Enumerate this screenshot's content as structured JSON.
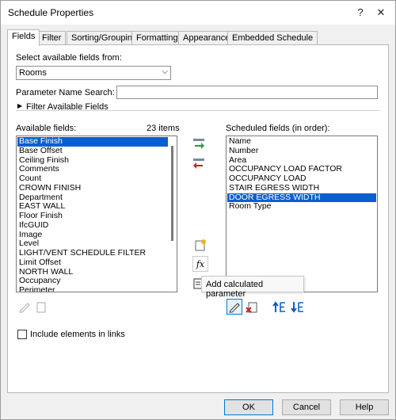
{
  "window": {
    "title": "Schedule Properties",
    "help_icon": "?",
    "close_icon": "✕"
  },
  "tabs": [
    "Fields",
    "Filter",
    "Sorting/Grouping",
    "Formatting",
    "Appearance",
    "Embedded Schedule"
  ],
  "fields": {
    "select_label": "Select available fields from:",
    "select_value": "Rooms",
    "param_search_label": "Parameter Name Search:",
    "param_search_value": "",
    "filter_label": "Filter Available Fields",
    "available_label": "Available fields:",
    "available_count": "23 items",
    "available_items": [
      "Base Finish",
      "Base Offset",
      "Ceiling Finish",
      "Comments",
      "Count",
      "CROWN FINISH",
      "Department",
      "EAST WALL",
      "Floor Finish",
      "IfcGUID",
      "Image",
      "Level",
      "LIGHT/VENT SCHEDULE FILTER",
      "Limit Offset",
      "NORTH WALL",
      "Occupancy",
      "Perimeter"
    ],
    "available_selected": 0,
    "scheduled_label": "Scheduled fields (in order):",
    "scheduled_items": [
      "Name",
      "Number",
      "Area",
      "OCCUPANCY LOAD FACTOR",
      "OCCUPANCY LOAD",
      "STAIR EGRESS WIDTH",
      "DOOR EGRESS WIDTH",
      "Room Type"
    ],
    "scheduled_selected": 6,
    "tooltip": "Add calculated parameter",
    "include_links_label": "Include elements in links",
    "include_links_checked": false
  },
  "buttons": {
    "ok": "OK",
    "cancel": "Cancel",
    "help": "Help"
  },
  "colors": {
    "selection": "#0a5fd0",
    "add_arrow": "#2e9a3a",
    "remove_arrow": "#d02020",
    "up_down": "#1060c0"
  }
}
